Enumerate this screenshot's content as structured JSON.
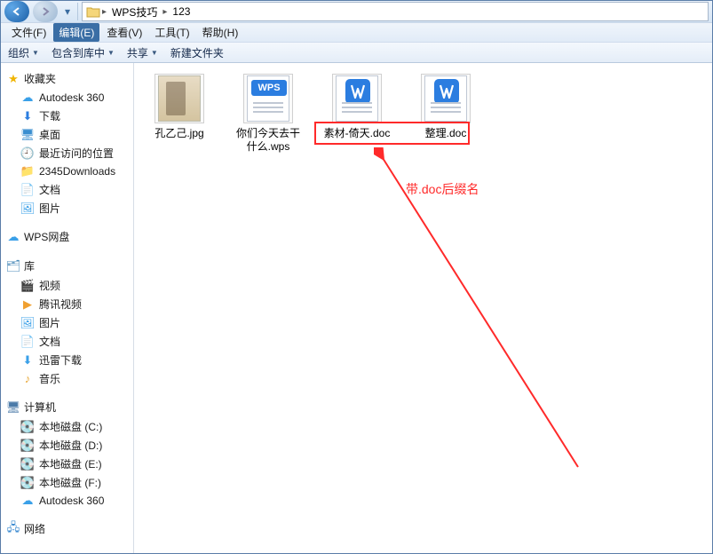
{
  "titlebar": {
    "breadcrumb": {
      "seg1": "WPS技巧",
      "seg2": "123"
    }
  },
  "menubar": {
    "file": "文件(F)",
    "edit": "编辑(E)",
    "view": "查看(V)",
    "tools": "工具(T)",
    "help": "帮助(H)"
  },
  "toolbar": {
    "organize": "组织",
    "include": "包含到库中",
    "share": "共享",
    "newfolder": "新建文件夹"
  },
  "sidebar": {
    "favorites": "收藏夹",
    "fav_items": [
      {
        "icon": "autodesk",
        "label": "Autodesk 360"
      },
      {
        "icon": "download",
        "label": "下载"
      },
      {
        "icon": "desktop",
        "label": "桌面"
      },
      {
        "icon": "recent",
        "label": "最近访问的位置"
      },
      {
        "icon": "folder",
        "label": "2345Downloads"
      },
      {
        "icon": "docs",
        "label": "文档"
      },
      {
        "icon": "pics",
        "label": "图片"
      }
    ],
    "wps": "WPS网盘",
    "libraries": "库",
    "lib_items": [
      {
        "icon": "video",
        "label": "视频"
      },
      {
        "icon": "tencent",
        "label": "腾讯视频"
      },
      {
        "icon": "pics",
        "label": "图片"
      },
      {
        "icon": "docs",
        "label": "文档"
      },
      {
        "icon": "xunlei",
        "label": "迅雷下载"
      },
      {
        "icon": "music",
        "label": "音乐"
      }
    ],
    "computer": "计算机",
    "drives": [
      {
        "label": "本地磁盘 (C:)"
      },
      {
        "label": "本地磁盘 (D:)"
      },
      {
        "label": "本地磁盘 (E:)"
      },
      {
        "label": "本地磁盘 (F:)"
      }
    ],
    "autodesk": "Autodesk 360",
    "network": "网络"
  },
  "files": [
    {
      "name": "孔乙己.jpg",
      "type": "jpg"
    },
    {
      "name": "你们今天去干什么.wps",
      "type": "wps"
    },
    {
      "name": "素材-倚天.doc",
      "type": "doc"
    },
    {
      "name": "整理.doc",
      "type": "doc"
    }
  ],
  "annotation": {
    "text": "带.doc后缀名"
  }
}
